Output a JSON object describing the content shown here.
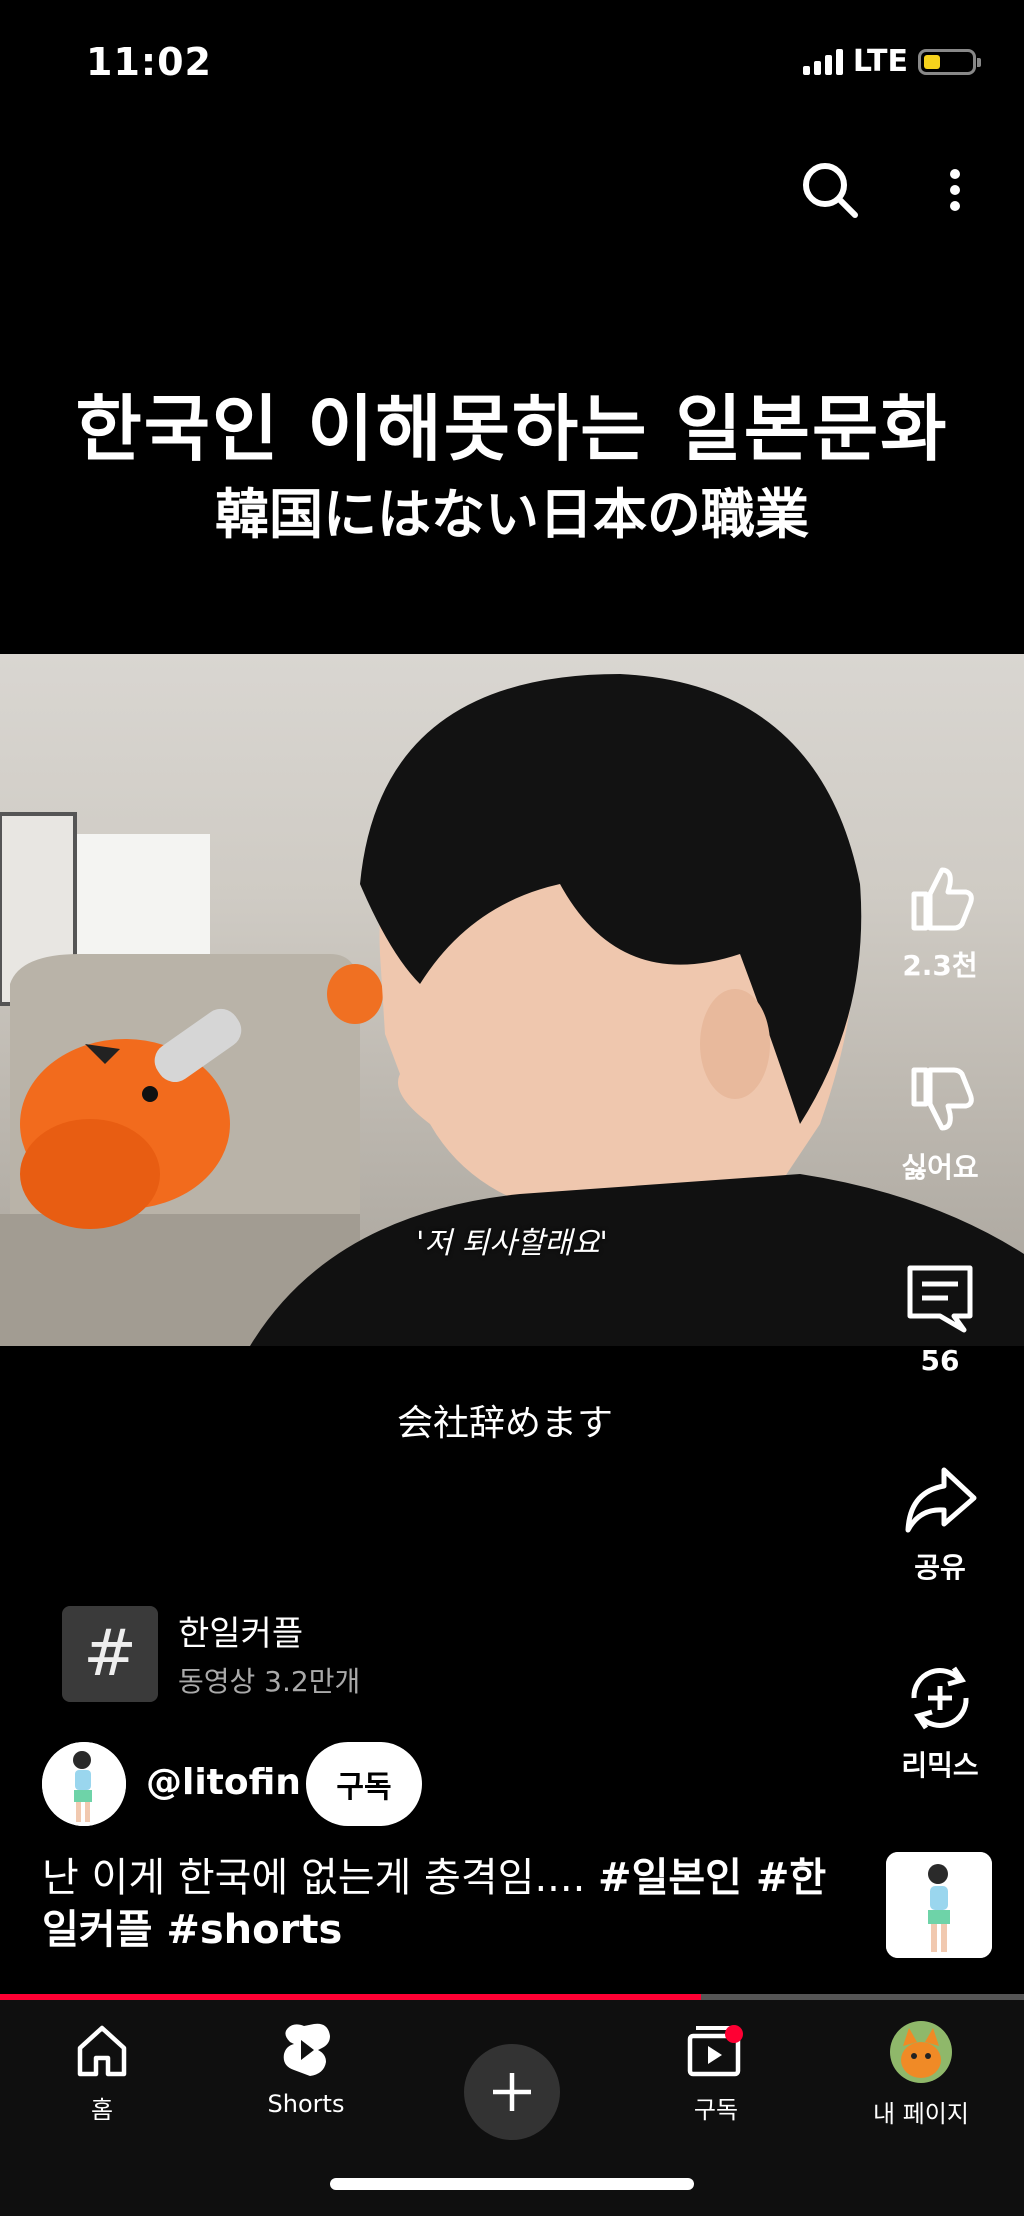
{
  "status_bar": {
    "time": "11:02",
    "network": "LTE",
    "battery_level": 0.35
  },
  "overlay_title": {
    "korean": "한국인 이해못하는 일본문화",
    "japanese": "韓国にはない日本の職業"
  },
  "video": {
    "caption": "'저 퇴사할래요'",
    "subtitle": "会社辞めます"
  },
  "actions": {
    "like_count": "2.3천",
    "dislike_label": "싫어요",
    "comment_count": "56",
    "share_label": "공유",
    "remix_label": "리믹스"
  },
  "hashtag": {
    "symbol": "#",
    "name": "한일커플",
    "count": "동영상 3.2만개"
  },
  "channel": {
    "handle": "@litofin",
    "subscribe_label": "구독"
  },
  "description": {
    "text": "난 이게 한국에 없는게 충격임.... ",
    "tags": "#일본인 #한일커플 #shorts"
  },
  "progress": 0.685,
  "nav": {
    "home": "홈",
    "shorts": "Shorts",
    "subscriptions": "구독",
    "my_page": "내 페이지"
  },
  "colors": {
    "accent": "#ff0033",
    "background": "#000000"
  }
}
